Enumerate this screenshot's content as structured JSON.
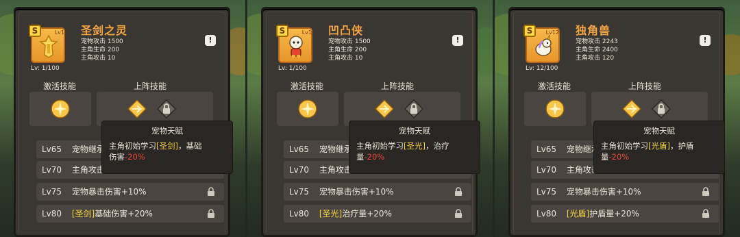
{
  "cards": [
    {
      "id": "card-0",
      "rank": "S",
      "rank_lv": "Lv1",
      "name": "圣剑之灵",
      "stats": [
        "宠物攻击 1500",
        "主角生命 200",
        "主角攻击 10"
      ],
      "lv_text": "Lv: 1/100",
      "info": "!",
      "active_skill_label": "激活技能",
      "deploy_skill_label": "上阵技能",
      "talents": [
        {
          "lvl": "Lv65",
          "pre": "",
          "hl": "",
          "text": "宠物继承"
        },
        {
          "lvl": "Lv70",
          "pre": "",
          "hl": "",
          "text": "主角攻击"
        },
        {
          "lvl": "Lv75",
          "pre": "",
          "hl": "",
          "text": "宠物暴击伤害+10%"
        },
        {
          "lvl": "Lv80",
          "pre": "",
          "hl": "[圣剑]",
          "text": "基础伤害+20%"
        }
      ],
      "tooltip": {
        "title": "宠物天赋",
        "line1_pre": "主角初始学习",
        "line1_hl": "[圣剑]",
        "line1_post": "，基础",
        "line2_pre": "伤害",
        "line2_neg": "-20%"
      }
    },
    {
      "id": "card-1",
      "rank": "S",
      "rank_lv": "Lv1",
      "name": "凹凸侠",
      "stats": [
        "宠物攻击 1500",
        "主角生命 200",
        "主角攻击 10"
      ],
      "lv_text": "Lv: 1/100",
      "info": "!",
      "active_skill_label": "激活技能",
      "deploy_skill_label": "上阵技能",
      "talents": [
        {
          "lvl": "Lv65",
          "pre": "",
          "hl": "",
          "text": "宠物继承"
        },
        {
          "lvl": "Lv70",
          "pre": "",
          "hl": "",
          "text": "主角攻击"
        },
        {
          "lvl": "Lv75",
          "pre": "",
          "hl": "",
          "text": "宠物暴击伤害+10%"
        },
        {
          "lvl": "Lv80",
          "pre": "",
          "hl": "[圣光]",
          "text": "治疗量+20%"
        }
      ],
      "tooltip": {
        "title": "宠物天赋",
        "line1_pre": "主角初始学习",
        "line1_hl": "[圣光]",
        "line1_post": "，治疗",
        "line2_pre": "量",
        "line2_neg": "-20%"
      }
    },
    {
      "id": "card-2",
      "rank": "S",
      "rank_lv": "Lv12",
      "name": "独角兽",
      "stats": [
        "宠物攻击 2243",
        "主角生命 2400",
        "主角攻击 120"
      ],
      "lv_text": "Lv: 12/100",
      "info": "!",
      "active_skill_label": "激活技能",
      "deploy_skill_label": "上阵技能",
      "talents": [
        {
          "lvl": "Lv65",
          "pre": "",
          "hl": "",
          "text": "宠物继承"
        },
        {
          "lvl": "Lv70",
          "pre": "",
          "hl": "",
          "text": "主角攻击"
        },
        {
          "lvl": "Lv75",
          "pre": "",
          "hl": "",
          "text": "宠物暴击伤害+10%"
        },
        {
          "lvl": "Lv80",
          "pre": "",
          "hl": "[光盾]",
          "text": "护盾量+20%"
        }
      ],
      "tooltip": {
        "title": "宠物天赋",
        "line1_pre": "主角初始学习",
        "line1_hl": "[光盾]",
        "line1_post": "，护盾",
        "line2_pre": "量",
        "line2_neg": "-20%"
      }
    }
  ],
  "colors": {
    "accent": "#f3a544",
    "highlight": "#f4d442",
    "negative": "#ef4a3c",
    "panel": "#3a3631"
  },
  "icons": {
    "active_skill": "star-burst-icon",
    "deploy_skill": "sparkle-diamond-icon",
    "locked": "lock-icon"
  }
}
